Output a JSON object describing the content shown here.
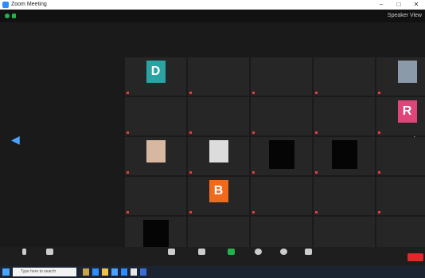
{
  "window": {
    "title": "Zoom Meeting"
  },
  "status": {
    "label": "Speaker View"
  },
  "tiles": [
    {
      "row": 0,
      "col": 0,
      "name": "",
      "caption": "",
      "type": "letter",
      "letter": "D",
      "color": "#2ba3a3"
    },
    {
      "row": 0,
      "col": 1,
      "name": "",
      "caption": "",
      "type": "text"
    },
    {
      "row": 0,
      "col": 2,
      "name": "",
      "caption": "",
      "type": "text"
    },
    {
      "row": 0,
      "col": 3,
      "name": "",
      "caption": "",
      "type": "text"
    },
    {
      "row": 0,
      "col": 4,
      "name": "",
      "caption": "",
      "type": "photo",
      "color": "#8a9aa8"
    },
    {
      "row": 1,
      "col": 0,
      "name": "",
      "caption": "",
      "type": "text"
    },
    {
      "row": 1,
      "col": 1,
      "name": "",
      "caption": "",
      "type": "text"
    },
    {
      "row": 1,
      "col": 2,
      "name": "",
      "caption": "",
      "type": "text"
    },
    {
      "row": 1,
      "col": 3,
      "name": "",
      "caption": "",
      "type": "text"
    },
    {
      "row": 1,
      "col": 4,
      "name": "",
      "caption": "",
      "type": "letter",
      "letter": "R",
      "color": "#e0457a"
    },
    {
      "row": 2,
      "col": 0,
      "name": "",
      "caption": "",
      "type": "photo",
      "color": "#d8b7a0"
    },
    {
      "row": 2,
      "col": 1,
      "name": "",
      "caption": "",
      "type": "photo",
      "color": "#dcdcdc"
    },
    {
      "row": 2,
      "col": 2,
      "name": "",
      "caption": "",
      "type": "black"
    },
    {
      "row": 2,
      "col": 3,
      "name": "",
      "caption": "",
      "type": "black"
    },
    {
      "row": 2,
      "col": 4,
      "name": "",
      "caption": "",
      "type": "text"
    },
    {
      "row": 3,
      "col": 0,
      "name": "",
      "caption": "",
      "type": "text"
    },
    {
      "row": 3,
      "col": 1,
      "name": "",
      "caption": "",
      "type": "letter",
      "letter": "B",
      "color": "#f06a1e"
    },
    {
      "row": 3,
      "col": 2,
      "name": "",
      "caption": "",
      "type": "text"
    },
    {
      "row": 3,
      "col": 3,
      "name": "",
      "caption": "",
      "type": "text"
    },
    {
      "row": 3,
      "col": 4,
      "name": "",
      "caption": "",
      "type": "text"
    },
    {
      "row": 4,
      "col": 0,
      "name": "",
      "caption": "",
      "type": "black"
    },
    {
      "row": 4,
      "col": 1,
      "name": "",
      "caption": "",
      "type": "text"
    },
    {
      "row": 4,
      "col": 2,
      "name": "",
      "caption": "",
      "type": "text"
    },
    {
      "row": 4,
      "col": 3,
      "name": "",
      "caption": "",
      "type": "text"
    },
    {
      "row": 4,
      "col": 4,
      "name": "",
      "caption": "",
      "type": "text"
    }
  ],
  "toolbar": {
    "end_label": ""
  },
  "taskbar": {
    "search_placeholder": "Type here to search"
  },
  "icons": {
    "left_arrow": "chevron-left-icon",
    "right_arrow": "chevron-right-icon"
  },
  "colors": {
    "toolbar_bg": "#1e1e1e",
    "end_red": "#e02828",
    "accent": "#2d8cff"
  }
}
